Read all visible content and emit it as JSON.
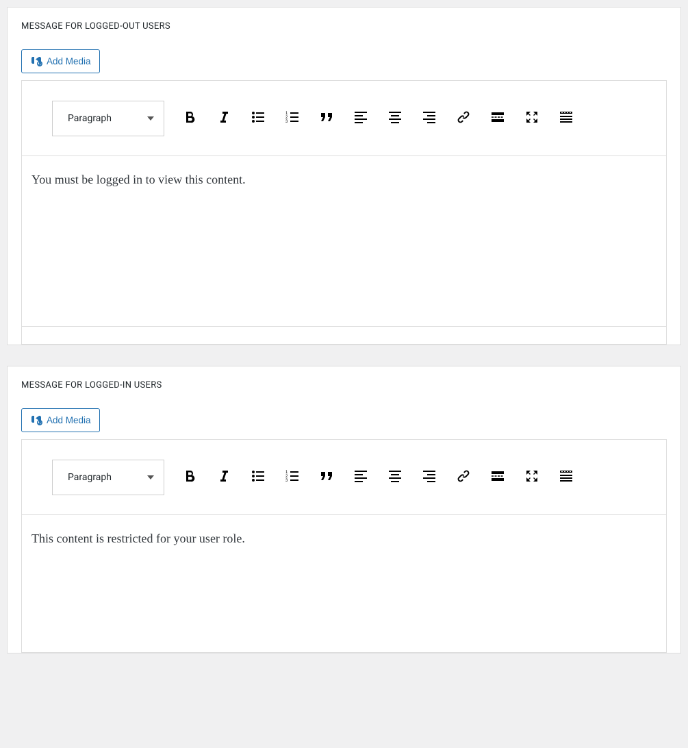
{
  "editors": [
    {
      "heading": "MESSAGE FOR LOGGED-OUT USERS",
      "add_media_label": "Add Media",
      "format_label": "Paragraph",
      "content": "You must be logged in to view this content."
    },
    {
      "heading": "MESSAGE FOR LOGGED-IN USERS",
      "add_media_label": "Add Media",
      "format_label": "Paragraph",
      "content": "This content is restricted for your user role."
    }
  ],
  "toolbar_icons": [
    "bold-icon",
    "italic-icon",
    "bullet-list-icon",
    "numbered-list-icon",
    "blockquote-icon",
    "align-left-icon",
    "align-center-icon",
    "align-right-icon",
    "link-icon",
    "read-more-icon",
    "fullscreen-icon",
    "toolbar-toggle-icon"
  ]
}
